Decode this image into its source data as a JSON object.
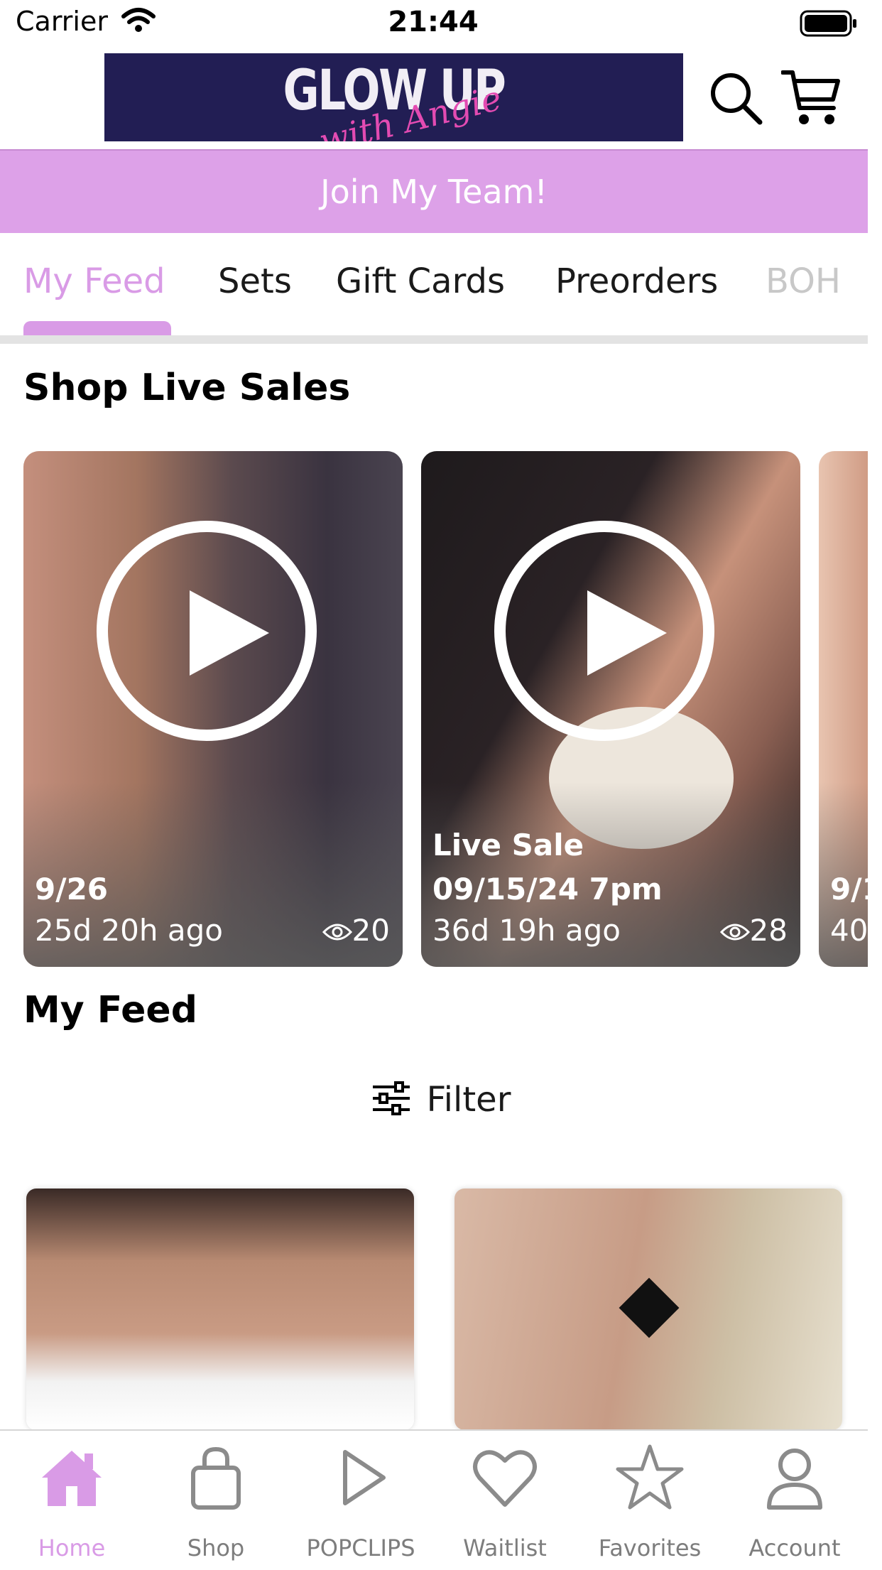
{
  "status_bar": {
    "carrier": "Carrier",
    "time": "21:44"
  },
  "header": {
    "logo_text": "GLOW UP",
    "logo_subtext": "with Angie",
    "join_banner": "Join My Team!"
  },
  "tabs": [
    "My Feed",
    "Sets",
    "Gift Cards",
    "Preorders",
    "BOH"
  ],
  "live_sales": {
    "title": "Shop Live Sales",
    "cards": [
      {
        "title_line1": "",
        "title_line2": "9/26",
        "ago": "25d 20h ago",
        "views": "20"
      },
      {
        "title_line1": "Live Sale",
        "title_line2": "09/15/24 7pm",
        "ago": "36d 19h ago",
        "views": "28"
      },
      {
        "title_line1": "",
        "title_line2": "9/1",
        "ago": "40",
        "views": ""
      }
    ]
  },
  "feed": {
    "title": "My Feed",
    "filter_label": "Filter"
  },
  "bottom_nav": [
    {
      "label": "Home",
      "icon": "home-icon"
    },
    {
      "label": "Shop",
      "icon": "shopping-bag-icon"
    },
    {
      "label": "POPCLIPS",
      "icon": "play-icon"
    },
    {
      "label": "Waitlist",
      "icon": "heart-icon"
    },
    {
      "label": "Favorites",
      "icon": "star-icon"
    },
    {
      "label": "Account",
      "icon": "person-icon"
    }
  ],
  "colors": {
    "accent": "#d99be6",
    "banner": "#dda1e8",
    "logo_bg": "#221e54"
  }
}
